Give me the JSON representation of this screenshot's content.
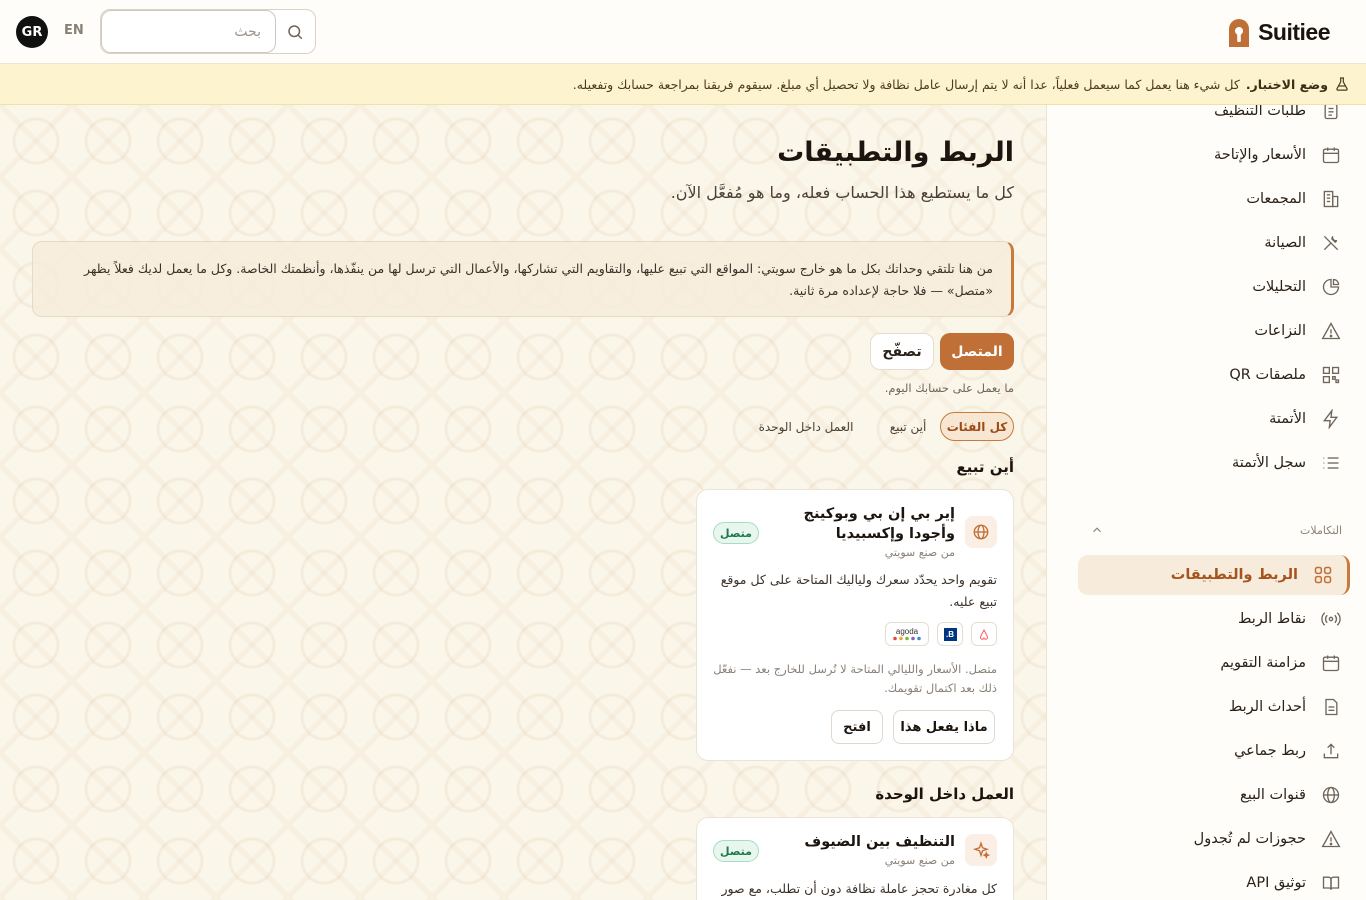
{
  "topbar": {
    "avatar_initials": "GR",
    "lang": "EN",
    "search_placeholder": "بحث",
    "brand_name": "Suitiee"
  },
  "banner": {
    "label": "وضع الاختبار.",
    "text": "كل شيء هنا يعمل كما سيعمل فعلياً، عدا أنه لا يتم إرسال عامل نظافة ولا تحصيل أي مبلغ. سيقوم فريقنا بمراجعة حسابك وتفعيله."
  },
  "sidebar": {
    "items_top": [
      {
        "label": "طلبات التنظيف",
        "icon": "clipboard-icon"
      },
      {
        "label": "الأسعار والإتاحة",
        "icon": "calendar-icon"
      },
      {
        "label": "المجمعات",
        "icon": "building-icon"
      },
      {
        "label": "الصيانة",
        "icon": "tools-icon"
      },
      {
        "label": "التحليلات",
        "icon": "pie-chart-icon"
      },
      {
        "label": "النزاعات",
        "icon": "warning-icon"
      },
      {
        "label": "ملصقات QR",
        "icon": "qr-code-icon"
      },
      {
        "label": "الأتمتة",
        "icon": "lightning-icon"
      },
      {
        "label": "سجل الأتمتة",
        "icon": "list-icon"
      }
    ],
    "section_label": "التكاملات",
    "items_integrations": [
      {
        "label": "الربط والتطبيقات",
        "icon": "grid-icon",
        "active": true
      },
      {
        "label": "نقاط الربط",
        "icon": "broadcast-icon"
      },
      {
        "label": "مزامنة التقويم",
        "icon": "calendar-sync-icon"
      },
      {
        "label": "أحداث الربط",
        "icon": "document-icon"
      },
      {
        "label": "ربط جماعي",
        "icon": "upload-icon"
      },
      {
        "label": "قنوات البيع",
        "icon": "globe-icon"
      },
      {
        "label": "حجوزات لم تُجدول",
        "icon": "warning-icon"
      },
      {
        "label": "توثيق API",
        "icon": "book-icon"
      }
    ]
  },
  "main": {
    "title": "الربط والتطبيقات",
    "subtitle": "كل ما يستطيع هذا الحساب فعله، وما هو مُفعَّل الآن.",
    "info": "من هنا تلتقي وحداتك بكل ما هو خارج سويتي: المواقع التي تبيع عليها، والتقاويم التي تشاركها، والأعمال التي ترسل لها من ينفّذها، وأنظمتك الخاصة. وكل ما يعمل لديك فعلاً يظهر «متصل» — فلا حاجة لإعداده مرة ثانية.",
    "segments": {
      "connected": "المتصل",
      "browse": "تصفّح"
    },
    "hint": "ما يعمل على حسابك اليوم.",
    "chips": {
      "all": "كل الفئات",
      "where_sell": "أين تبيع",
      "in_unit": "العمل داخل الوحدة"
    },
    "section_sell": "أين تبيع",
    "section_unit": "العمل داخل الوحدة"
  },
  "cards": [
    {
      "title": "إير بي إن بي وبوكينج وأجودا وإكسبيديا",
      "maker": "من صنع سويتي",
      "badge": "متصل",
      "desc": "تقويم واحد يحدّد سعرك ولياليك المتاحة على كل موقع تبيع عليه.",
      "brands": [
        "airbnb",
        "B.",
        "agoda"
      ],
      "status": "متصل. الأسعار والليالي المتاحة لا تُرسل للخارج بعد — نفعّل ذلك بعد اكتمال تقويمك.",
      "btn_what": "ماذا يفعل هذا",
      "btn_open": "افتح"
    },
    {
      "title": "التنظيف بين الضيوف",
      "maker": "من صنع سويتي",
      "badge": "متصل",
      "desc": "كل مغادرة تحجز عاملة نظافة دون أن تطلب، مع صور قبل"
    }
  ],
  "colors": {
    "accent": "#c06f36",
    "success": "#1f7a4a",
    "banner_bg": "#fdf3cf"
  }
}
